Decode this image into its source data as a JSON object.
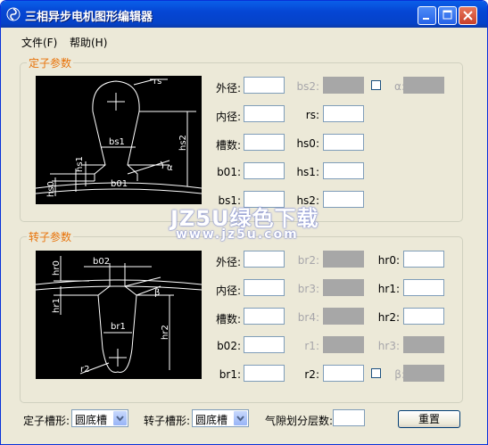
{
  "window": {
    "title": "三相异步电机图形编辑器"
  },
  "menu": [
    {
      "label": "文件(F)"
    },
    {
      "label": "帮助(H)"
    }
  ],
  "stator": {
    "title": "定子参数",
    "labels": {
      "outer": "外径:",
      "inner": "内径:",
      "slots": "槽数:",
      "b01": "b01:",
      "bs1": "bs1:",
      "bs2": "bs2:",
      "rs": "rs:",
      "hs0": "hs0:",
      "hs1": "hs1:",
      "hs2": "hs2:",
      "alpha": "α:"
    },
    "diagram": {
      "rs": "rs",
      "bs1": "bs1",
      "hs2": "hs2",
      "hs1": "hs1",
      "hs0": "hs0",
      "b01": "b01",
      "alpha": "α"
    }
  },
  "rotor": {
    "title": "转子参数",
    "labels": {
      "outer": "外径:",
      "inner": "内径:",
      "slots": "槽数:",
      "b02": "b02:",
      "br1": "br1:",
      "br2": "br2:",
      "br3": "br3:",
      "br4": "br4:",
      "r1": "r1:",
      "r2": "r2:",
      "hr0": "hr0:",
      "hr1": "hr1:",
      "hr2": "hr2:",
      "hr3": "hr3:",
      "beta": "β:"
    },
    "diagram": {
      "hr0": "hr0",
      "b02": "b02",
      "hr1": "hr1",
      "beta": "β",
      "br1": "br1",
      "hr2": "hr2",
      "r2": "r2"
    }
  },
  "bottom": {
    "stator_slot_label": "定子槽形:",
    "stator_slot_value": "圆底槽",
    "rotor_slot_label": "转子槽形:",
    "rotor_slot_value": "圆底槽",
    "airgap_label": "气隙划分层数:",
    "reset_label": "重置"
  },
  "watermark": {
    "line1": "JZ5U绿色下载",
    "line2": "www.jz5u.com"
  }
}
